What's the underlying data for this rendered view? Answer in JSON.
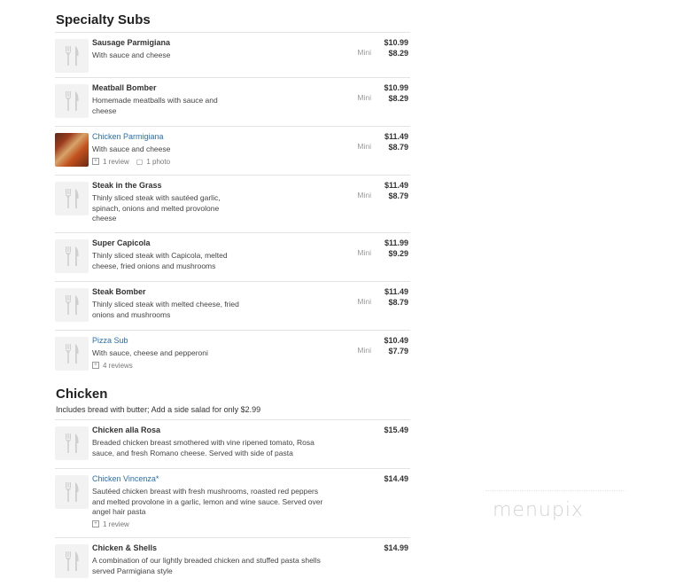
{
  "sections": {
    "specialty": {
      "title": "Specialty Subs",
      "items": [
        {
          "name": "Sausage Parmigiana",
          "desc": "With sauce and cheese",
          "price1": "$10.99",
          "mini": "Mini",
          "price2": "$8.29"
        },
        {
          "name": "Meatball Bomber",
          "desc": "Homemade meatballs with sauce and cheese",
          "price1": "$10.99",
          "mini": "Mini",
          "price2": "$8.29"
        },
        {
          "name": "Chicken Parmigiana",
          "desc": "With sauce and cheese",
          "reviews": "1 review",
          "photos": "1 photo",
          "price1": "$11.49",
          "mini": "Mini",
          "price2": "$8.79"
        },
        {
          "name": "Steak in the Grass",
          "desc": "Thinly sliced steak with sautéed garlic, spinach, onions and melted provolone cheese",
          "price1": "$11.49",
          "mini": "Mini",
          "price2": "$8.79"
        },
        {
          "name": "Super Capicola",
          "desc": "Thinly sliced steak with Capicola, melted cheese, fried onions and mushrooms",
          "price1": "$11.99",
          "mini": "Mini",
          "price2": "$9.29"
        },
        {
          "name": "Steak Bomber",
          "desc": "Thinly sliced steak with melted cheese, fried onions and mushrooms",
          "price1": "$11.49",
          "mini": "Mini",
          "price2": "$8.79"
        },
        {
          "name": "Pizza Sub",
          "desc": "With sauce, cheese and pepperoni",
          "reviews": "4 reviews",
          "price1": "$10.49",
          "mini": "Mini",
          "price2": "$7.79"
        }
      ]
    },
    "chicken": {
      "title": "Chicken",
      "note": "Includes bread with butter; Add a side salad for only $2.99",
      "items": [
        {
          "name": "Chicken alla Rosa",
          "desc": "Breaded chicken breast smothered with vine ripened tomato, Rosa sauce, and fresh Romano cheese. Served with side of pasta",
          "price1": "$15.49"
        },
        {
          "name": "Chicken Vincenza*",
          "desc": "Sautéed chicken breast with fresh mushrooms, roasted red peppers and melted provolone in a garlic, lemon and wine sauce. Served over angel hair pasta",
          "reviews": "1 review",
          "price1": "$14.49"
        },
        {
          "name": "Chicken & Shells",
          "desc": "A combination of our lightly breaded chicken and stuffed pasta shells served Parmigiana style",
          "price1": "$14.99"
        }
      ]
    }
  },
  "watermark": "menupix",
  "colors": {
    "link": "#2a6fb0",
    "divider": "#e3e3e3",
    "muted": "#999999"
  }
}
